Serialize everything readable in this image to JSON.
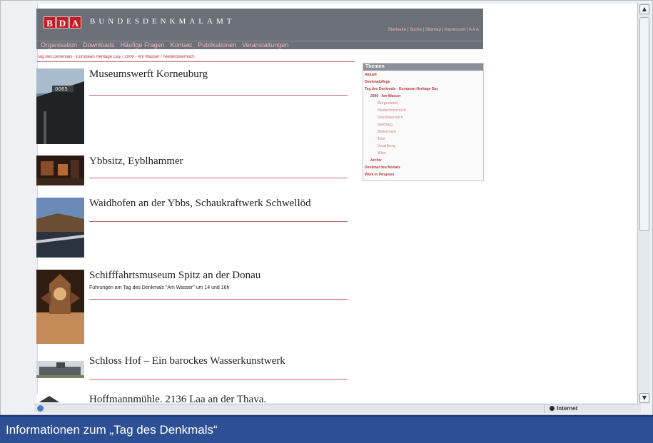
{
  "header": {
    "logo_letters": [
      "B",
      "D",
      "A"
    ],
    "wordmark": "BUNDESDENKMALAMT",
    "util_links": "Startseite | Suche | Sitemap | Impressum | A A A"
  },
  "nav": [
    "Organisation",
    "Downloads",
    "Häufige Fragen",
    "Kontakt",
    "Publikationen",
    "Veranstaltungen"
  ],
  "breadcrumb": "Tag des Denkmals - European Heritage Day / 2006 - Am Wasser / Niederösterreich",
  "entries": [
    {
      "title": "Museumswerft Korneuburg",
      "subtitle": ""
    },
    {
      "title": "Ybbsitz, Eyblhammer",
      "subtitle": ""
    },
    {
      "title": "Waidhofen an der Ybbs, Schaukraftwerk Schwellöd",
      "subtitle": ""
    },
    {
      "title": "Schifffahrtsmuseum Spitz an der Donau",
      "subtitle": "Führungen am Tag des Denkmals \"Am Wasser\" um 14 und 16h"
    },
    {
      "title": "Schloss Hof – Ein barockes Wasserkunstwerk",
      "subtitle": ""
    },
    {
      "title": "Hoffmannmühle, 2136 Laa an der Thaya,",
      "subtitle": ""
    }
  ],
  "themen": {
    "title": "Themen",
    "items": [
      {
        "label": "Aktuell"
      },
      {
        "label": "Denkmalpflege"
      },
      {
        "label": "Tag des Denkmals - European Heritage Day"
      },
      {
        "label": "2006 - Am Wasser"
      },
      {
        "label": "Burgenland"
      },
      {
        "label": "Niederösterreich"
      },
      {
        "label": "Oberösterreich"
      },
      {
        "label": "Salzburg"
      },
      {
        "label": "Steiermark"
      },
      {
        "label": "Tirol"
      },
      {
        "label": "Vorarlberg"
      },
      {
        "label": "Wien"
      },
      {
        "label": "Archiv"
      },
      {
        "label": "Denkmal des Monats"
      },
      {
        "label": "Work in Progress"
      }
    ]
  },
  "status": {
    "zone": "Internet"
  },
  "caption": "Informationen zum „Tag des Denkmals“",
  "colors": {
    "accent_red": "#c31d23",
    "header_gray": "#6b6f78",
    "caption_blue": "#2d4f93"
  }
}
